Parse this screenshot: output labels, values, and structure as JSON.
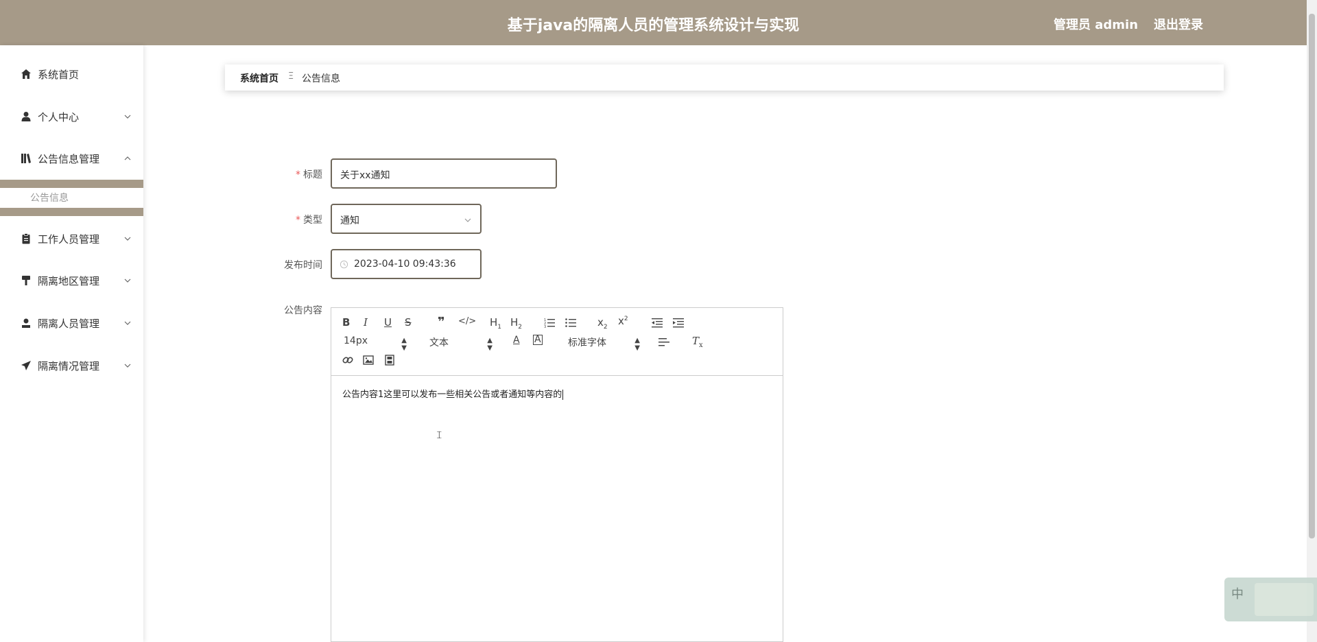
{
  "header": {
    "title": "基于java的隔离人员的管理系统设计与实现",
    "user": "管理员 admin",
    "logout": "退出登录"
  },
  "sidebar": {
    "items": [
      {
        "label": "系统首页",
        "icon": "home-icon"
      },
      {
        "label": "个人中心",
        "icon": "user-icon"
      },
      {
        "label": "公告信息管理",
        "icon": "book-icon"
      },
      {
        "label": "工作人员管理",
        "icon": "clipboard-icon"
      },
      {
        "label": "隔离地区管理",
        "icon": "brush-icon"
      },
      {
        "label": "隔离人员管理",
        "icon": "person-icon"
      },
      {
        "label": "隔离情况管理",
        "icon": "send-icon"
      }
    ],
    "submenu_item": "公告信息"
  },
  "breadcrumb": {
    "home": "系统首页",
    "separator": "Ξ",
    "current": "公告信息"
  },
  "form": {
    "title_label": "标题",
    "title_value": "关于xx通知",
    "type_label": "类型",
    "type_value": "通知",
    "time_label": "发布时间",
    "time_value": "2023-04-10 09:43:36",
    "content_label": "公告内容",
    "required_mark": "*"
  },
  "editor": {
    "font_size": "14px",
    "header_select": "文本",
    "font_family": "标准字体",
    "content": "公告内容1这里可以发布一些相关公告或者通知等内容的"
  },
  "ime": {
    "mode": "中"
  },
  "colors": {
    "header_bg": "#a69a88",
    "required": "#e95757",
    "border": "#6e6659"
  }
}
